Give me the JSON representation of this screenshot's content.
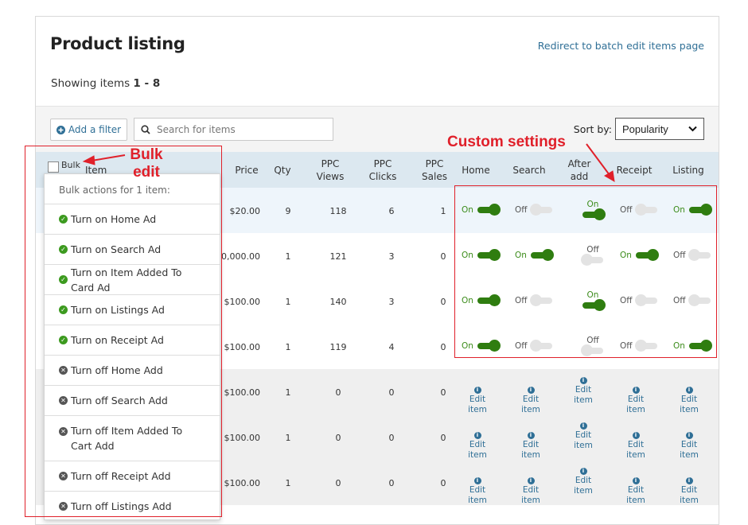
{
  "page": {
    "title": "Product listing",
    "redirect_link": "Redirect to batch edit items page",
    "showing_prefix": "Showing items ",
    "showing_range": "1 - 8"
  },
  "toolbar": {
    "filter_label": "Add a filter",
    "search_placeholder": "Search for items",
    "sort_label": "Sort by:",
    "sort_value": "Popularity"
  },
  "table": {
    "headers": {
      "bulk": "Bulk",
      "item": "Item",
      "price": "Price",
      "qty": "Qty",
      "ppc_views": [
        "PPC",
        "Views"
      ],
      "ppc_clicks": [
        "PPC",
        "Clicks"
      ],
      "ppc_sales": [
        "PPC",
        "Sales"
      ],
      "home": "Home",
      "search": "Search",
      "after_add": [
        "After",
        "add"
      ],
      "receipt": "Receipt",
      "listing": "Listing"
    },
    "rows": [
      {
        "price": "$20.00",
        "qty": "9",
        "views": "118",
        "clicks": "6",
        "sales": "1",
        "settings": [
          "On",
          "Off",
          "On",
          "Off",
          "On"
        ]
      },
      {
        "price": "0,000.00",
        "qty": "1",
        "views": "121",
        "clicks": "3",
        "sales": "0",
        "settings": [
          "On",
          "On",
          "Off",
          "On",
          "Off"
        ]
      },
      {
        "price": "$100.00",
        "qty": "1",
        "views": "140",
        "clicks": "3",
        "sales": "0",
        "settings": [
          "On",
          "Off",
          "On",
          "Off",
          "Off"
        ]
      },
      {
        "price": "$100.00",
        "qty": "1",
        "views": "119",
        "clicks": "4",
        "sales": "0",
        "settings": [
          "On",
          "Off",
          "Off",
          "Off",
          "On"
        ]
      },
      {
        "price": "$100.00",
        "qty": "1",
        "views": "0",
        "clicks": "0",
        "sales": "0",
        "edit": true
      },
      {
        "price": "$100.00",
        "qty": "1",
        "views": "0",
        "clicks": "0",
        "sales": "0",
        "edit": true
      },
      {
        "price": "$100.00",
        "qty": "1",
        "views": "0",
        "clicks": "0",
        "sales": "0",
        "edit": true
      }
    ],
    "edit_label": "Edit item",
    "edit_label_split": [
      "Edit",
      "item"
    ],
    "info_glyph": "i"
  },
  "bulk_menu": {
    "heading": "Bulk actions for 1 item:",
    "items": [
      {
        "label": "Turn on Home Ad",
        "icon": "check-circle-icon"
      },
      {
        "label": "Turn on Search Ad",
        "icon": "check-circle-icon"
      },
      {
        "label": "Turn on Item Added To Card Ad",
        "icon": "check-circle-icon"
      },
      {
        "label": "Turn on Listings Ad",
        "icon": "check-circle-icon"
      },
      {
        "label": "Turn on Receipt Ad",
        "icon": "check-circle-icon"
      },
      {
        "label": "Turn off Home Add",
        "icon": "x-circle-icon"
      },
      {
        "label": "Turn off Search Add",
        "icon": "x-circle-icon"
      },
      {
        "label": "Turn off Item Added To Cart Add",
        "icon": "x-circle-icon"
      },
      {
        "label": "Turn off Receipt Add",
        "icon": "x-circle-icon"
      },
      {
        "label": "Turn off Listings Add",
        "icon": "x-circle-icon"
      }
    ]
  },
  "annotations": {
    "bulk_edit": [
      "Bulk",
      "edit"
    ],
    "custom_settings": "Custom settings",
    "color": "#e0202a"
  },
  "colors": {
    "toggle_on": "#2f7d10",
    "toggle_off": "#e3e3e3",
    "link": "#2f6f96",
    "header_bg": "#dce8f0"
  }
}
